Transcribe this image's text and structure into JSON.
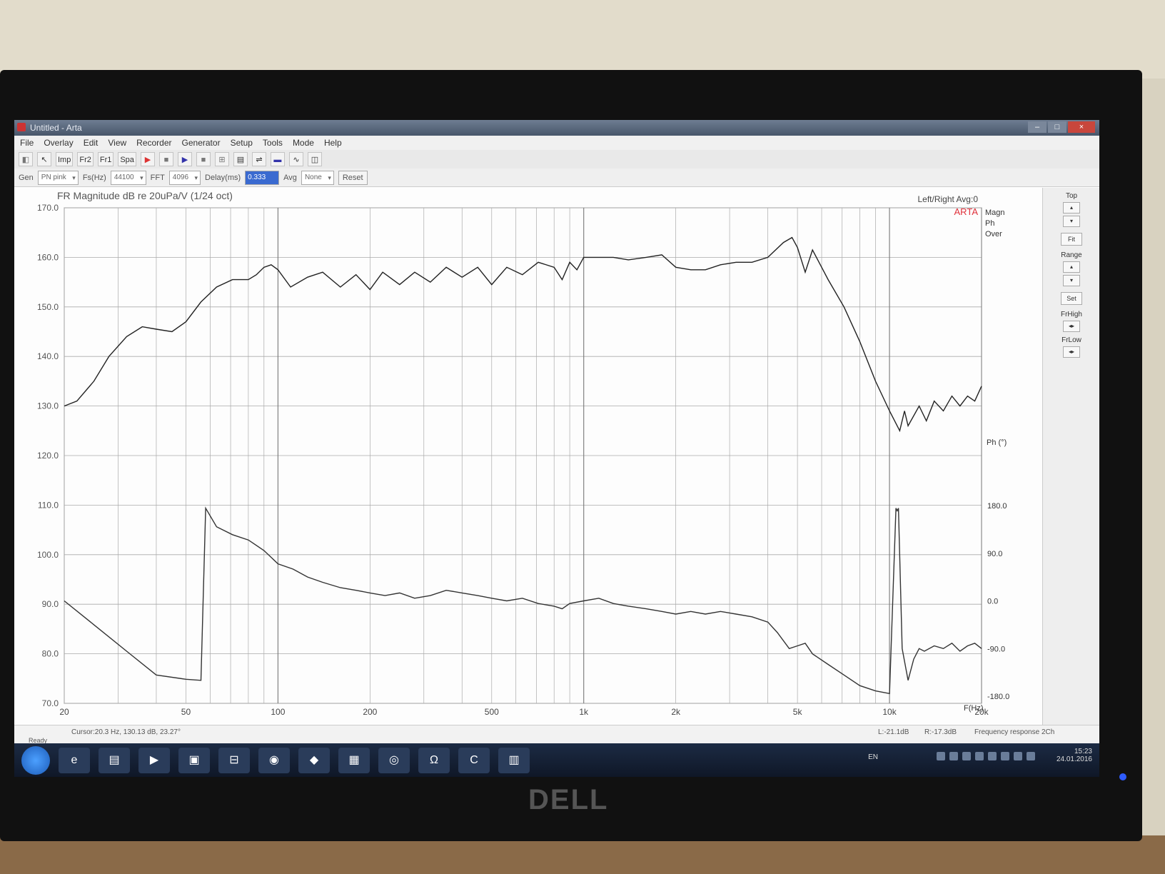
{
  "window": {
    "title": "Untitled - Arta"
  },
  "menu": [
    "File",
    "Overlay",
    "Edit",
    "View",
    "Recorder",
    "Generator",
    "Setup",
    "Tools",
    "Mode",
    "Help"
  ],
  "toolbar": {
    "buttons": [
      "Imp",
      "Fr2",
      "Fr1",
      "Spa"
    ]
  },
  "options": {
    "gen_label": "Gen",
    "gen_value": "PN pink",
    "fs_label": "Fs(Hz)",
    "fs_value": "44100",
    "fft_label": "FFT",
    "fft_value": "4096",
    "delay_label": "Delay(ms)",
    "delay_value": "0.333",
    "avg_label": "Avg",
    "avg_value": "None",
    "reset_label": "Reset"
  },
  "sidepanel": {
    "top_label": "Top",
    "fit_label": "Fit",
    "range_label": "Range",
    "set_label": "Set",
    "frhigh_label": "FrHigh",
    "frlow_label": "FrLow"
  },
  "status": {
    "ready": "Ready",
    "cursor": "Cursor:20.3 Hz, 130.13 dB, 23.27°",
    "left": "L:-21.1dB",
    "right": "R:-17.3dB",
    "mode": "Frequency response 2Ch"
  },
  "taskbar": {
    "lang": "EN",
    "time": "15:23",
    "date": "24.01.2016",
    "omega": "Ω"
  },
  "brand": "DELL",
  "chart_data": {
    "type": "line",
    "title": "FR Magnitude dB re 20uPa/V (1/24 oct)",
    "subtitle": "Left/Right  Avg:0",
    "brand_label": "ARTA",
    "legend": [
      "Magn",
      "Ph",
      "Over"
    ],
    "xlabel": "F(Hz)",
    "xscale": "log",
    "xlim": [
      20,
      20000
    ],
    "x_ticks": [
      20,
      50,
      100,
      200,
      500,
      1000,
      2000,
      5000,
      10000,
      20000
    ],
    "x_tick_labels": [
      "20",
      "50",
      "100",
      "200",
      "500",
      "1k",
      "2k",
      "5k",
      "10k",
      "20k"
    ],
    "ylim": [
      70,
      170
    ],
    "y_ticks": [
      "170.0",
      "160.0",
      "150.0",
      "140.0",
      "130.0",
      "120.0",
      "110.0",
      "100.0",
      "90.0",
      "80.0",
      "70.0"
    ],
    "y2label": "Ph (°)",
    "y2lim": [
      -180,
      180
    ],
    "y2_ticks": [
      "180.0",
      "90.0",
      "0.0",
      "-90.0",
      "-180.0"
    ],
    "grid": true,
    "series": [
      {
        "name": "Magn",
        "axis": "left",
        "x": [
          20,
          22,
          25,
          28,
          32,
          36,
          40,
          45,
          50,
          56,
          63,
          71,
          80,
          85,
          90,
          95,
          100,
          110,
          125,
          140,
          160,
          180,
          200,
          220,
          250,
          280,
          315,
          355,
          400,
          450,
          500,
          560,
          630,
          710,
          800,
          850,
          900,
          950,
          1000,
          1120,
          1250,
          1400,
          1600,
          1800,
          2000,
          2240,
          2500,
          2800,
          3150,
          3550,
          4000,
          4500,
          4800,
          5000,
          5300,
          5600,
          6000,
          6300,
          7100,
          8000,
          9000,
          10000,
          10800,
          11200,
          11500,
          12500,
          13200,
          14000,
          15000,
          16000,
          17000,
          18000,
          19000,
          20000
        ],
        "y": [
          130,
          131,
          135,
          140,
          144,
          146,
          145.5,
          145,
          147,
          151,
          154,
          155.5,
          155.5,
          156.5,
          158,
          158.5,
          157.5,
          154,
          156,
          157,
          154,
          156.5,
          153.5,
          157,
          154.5,
          157,
          155,
          158,
          156,
          158,
          154.5,
          158,
          156.5,
          159,
          158,
          155.5,
          159,
          157.5,
          160,
          160,
          160,
          159.5,
          160,
          160.5,
          158,
          157.5,
          157.5,
          158.5,
          159,
          159,
          160,
          163,
          164,
          162,
          157,
          161.5,
          158,
          155.5,
          150,
          143,
          135,
          129,
          125,
          129,
          126,
          130,
          127,
          131,
          129,
          132,
          130,
          132,
          131,
          134
        ]
      },
      {
        "name": "Ph",
        "axis": "right",
        "x": [
          20,
          25,
          32,
          40,
          50,
          56,
          58,
          63,
          71,
          80,
          90,
          100,
          112,
          125,
          140,
          160,
          180,
          200,
          224,
          250,
          280,
          315,
          355,
          400,
          450,
          500,
          560,
          630,
          710,
          800,
          850,
          900,
          1000,
          1120,
          1250,
          1400,
          1600,
          1800,
          2000,
          2240,
          2500,
          2800,
          3150,
          3550,
          4000,
          4300,
          4700,
          5000,
          5300,
          5600,
          6300,
          7100,
          8000,
          9000,
          10000,
          10500,
          10600,
          10700,
          11000,
          11500,
          12000,
          12500,
          13000,
          14000,
          15000,
          16000,
          17000,
          18000,
          19000,
          20000
        ],
        "y": [
          0,
          -45,
          -95,
          -140,
          -148,
          -150,
          175,
          140,
          125,
          115,
          95,
          70,
          60,
          45,
          35,
          25,
          20,
          15,
          10,
          15,
          5,
          10,
          20,
          15,
          10,
          5,
          0,
          5,
          -5,
          -10,
          -15,
          -5,
          0,
          5,
          -5,
          -10,
          -15,
          -20,
          -25,
          -20,
          -25,
          -20,
          -25,
          -30,
          -40,
          -60,
          -90,
          -85,
          -80,
          -100,
          -120,
          -140,
          -160,
          -170,
          -175,
          175,
          170,
          175,
          -90,
          -150,
          -110,
          -90,
          -95,
          -85,
          -90,
          -80,
          -95,
          -85,
          -80,
          -90
        ]
      }
    ]
  }
}
